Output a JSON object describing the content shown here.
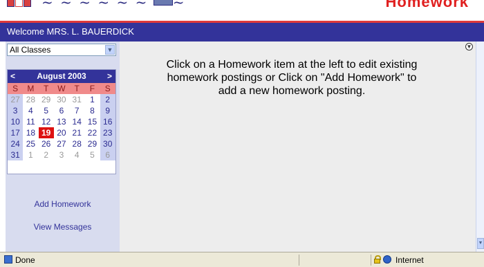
{
  "header": {
    "banner_right": "Homework"
  },
  "welcome": {
    "text": "Welcome MRS. L. BAUERDICK"
  },
  "sidebar": {
    "class_select": {
      "selected": "All Classes"
    },
    "calendar": {
      "prev": "<",
      "next": ">",
      "title": "August 2003",
      "days_of_week": [
        "S",
        "M",
        "T",
        "W",
        "T",
        "F",
        "S"
      ],
      "weeks": [
        [
          "27",
          "28",
          "29",
          "30",
          "31",
          "1",
          "2"
        ],
        [
          "3",
          "4",
          "5",
          "6",
          "7",
          "8",
          "9"
        ],
        [
          "10",
          "11",
          "12",
          "13",
          "14",
          "15",
          "16"
        ],
        [
          "17",
          "18",
          "19",
          "20",
          "21",
          "22",
          "23"
        ],
        [
          "24",
          "25",
          "26",
          "27",
          "28",
          "29",
          "30"
        ],
        [
          "31",
          "1",
          "2",
          "3",
          "4",
          "5",
          "6"
        ]
      ],
      "today": "19"
    },
    "links": {
      "add_homework": "Add Homework",
      "view_messages": "View Messages"
    }
  },
  "main": {
    "instructions": "Click on a Homework item at the left to edit existing homework postings or Click on \"Add Homework\" to add a new homework posting."
  },
  "statusbar": {
    "status": "Done",
    "zone": "Internet"
  },
  "colors": {
    "brand_blue": "#33339a",
    "accent_red": "#e03a3a",
    "weekday_header": "#f08a8a",
    "today": "#dd1111"
  }
}
